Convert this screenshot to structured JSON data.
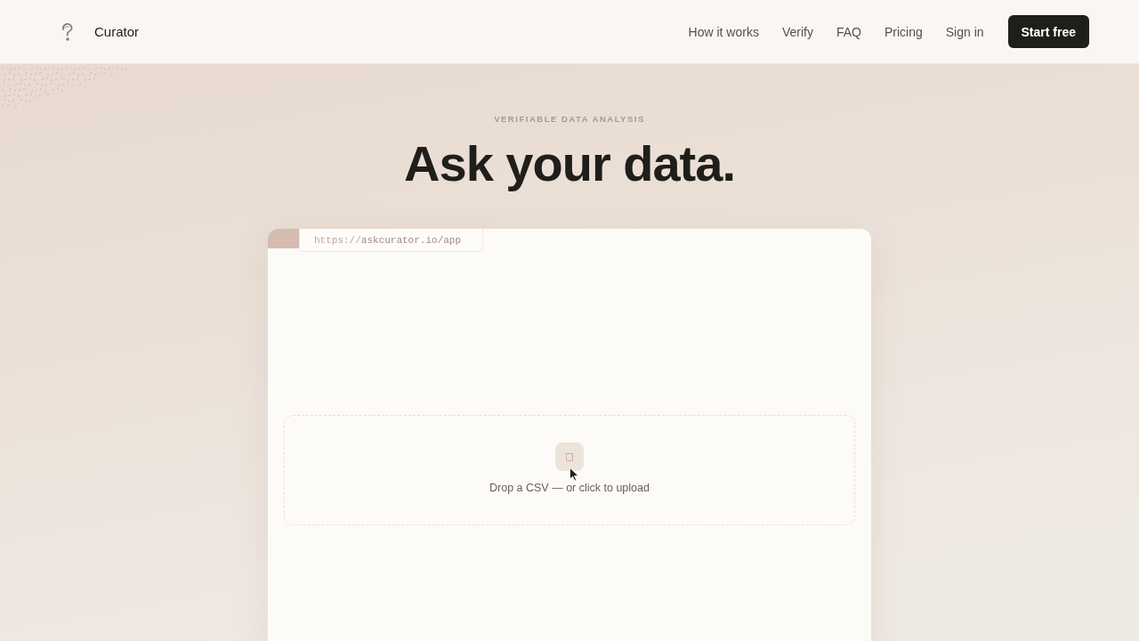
{
  "header": {
    "brand": "Curator",
    "nav": [
      "How it works",
      "Verify",
      "FAQ",
      "Pricing",
      "Sign in"
    ],
    "cta": "Start free"
  },
  "hero": {
    "eyebrow": "VERIFIABLE DATA ANALYSIS",
    "title": "Ask your data."
  },
  "browser": {
    "address_scheme": "https://",
    "address_rest": "askcurator.io/app",
    "dropzone": {
      "label": "Drop a CSV — or click to upload"
    }
  }
}
